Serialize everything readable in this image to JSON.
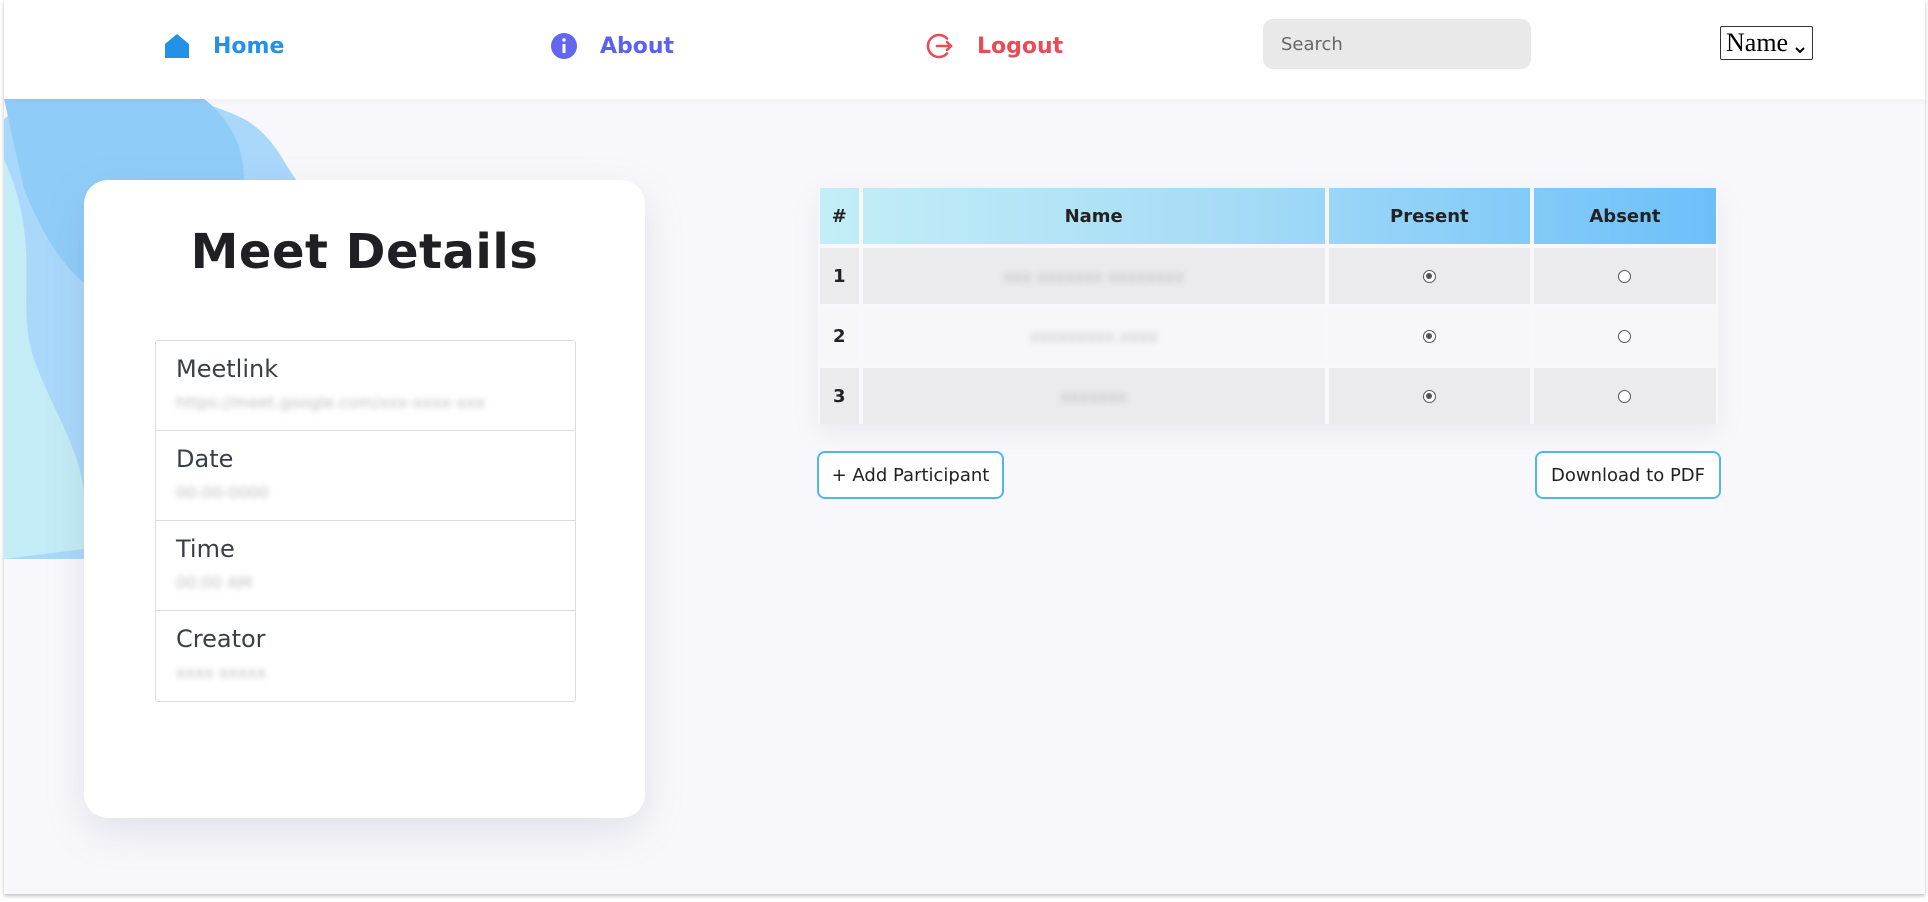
{
  "nav": {
    "home_label": "Home",
    "about_label": "About",
    "logout_label": "Logout",
    "search_placeholder": "Search",
    "sort_select_value": "Name",
    "colors": {
      "home": "#2591e6",
      "about": "#5c60f0",
      "logout": "#ea4c56"
    }
  },
  "icons": {
    "home": "home-icon",
    "about": "info-icon",
    "logout": "logout-icon",
    "select": "chevron-down-icon"
  },
  "details": {
    "title": "Meet Details",
    "items": [
      {
        "label": "Meetlink",
        "value": "https://meet.google.com/xxx-xxxx-xxx"
      },
      {
        "label": "Date",
        "value": "00-00-0000"
      },
      {
        "label": "Time",
        "value": "00:00 AM"
      },
      {
        "label": "Creator",
        "value": "xxxx xxxxx"
      }
    ]
  },
  "attendance": {
    "headers": [
      "#",
      "Name",
      "Present",
      "Absent"
    ],
    "rows": [
      {
        "num": "1",
        "name": "xxx xxxxxxx xxxxxxxx",
        "present": true,
        "absent": false
      },
      {
        "num": "2",
        "name": "xxxxxxxxx xxxx",
        "present": true,
        "absent": false
      },
      {
        "num": "3",
        "name": "xxxxxxx",
        "present": true,
        "absent": false
      }
    ]
  },
  "actions": {
    "add_label": "+ Add Participant",
    "pdf_label": "Download to PDF"
  }
}
